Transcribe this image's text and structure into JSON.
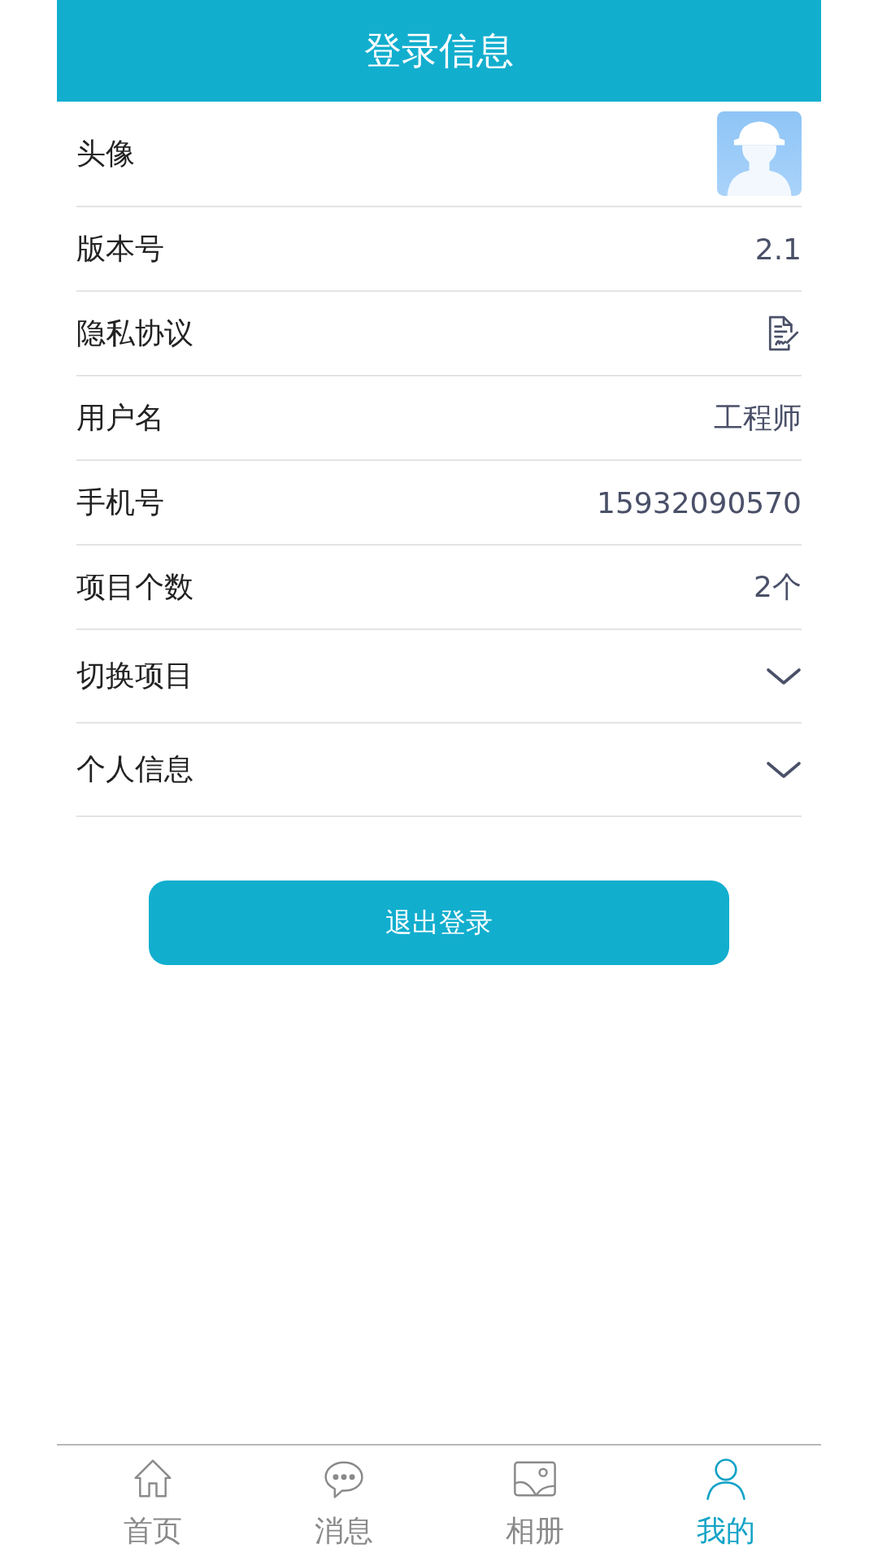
{
  "header": {
    "title": "登录信息"
  },
  "rows": [
    {
      "kind": "avatar",
      "label": "头像"
    },
    {
      "kind": "text",
      "label": "版本号",
      "value": "2.1"
    },
    {
      "kind": "document",
      "label": "隐私协议"
    },
    {
      "kind": "text",
      "label": "用户名",
      "value": "工程师"
    },
    {
      "kind": "text",
      "label": "手机号",
      "value": "15932090570"
    },
    {
      "kind": "text",
      "label": "项目个数",
      "value": "2个"
    },
    {
      "kind": "dropdown",
      "label": "切换项目"
    },
    {
      "kind": "dropdown",
      "label": "个人信息"
    }
  ],
  "logout_button": "退出登录",
  "tabs": [
    {
      "kind": "home",
      "label": "首页",
      "selected": false
    },
    {
      "kind": "chat",
      "label": "消息",
      "selected": false
    },
    {
      "kind": "photo",
      "label": "相册",
      "selected": false
    },
    {
      "kind": "person",
      "label": "我的",
      "selected": true
    }
  ]
}
